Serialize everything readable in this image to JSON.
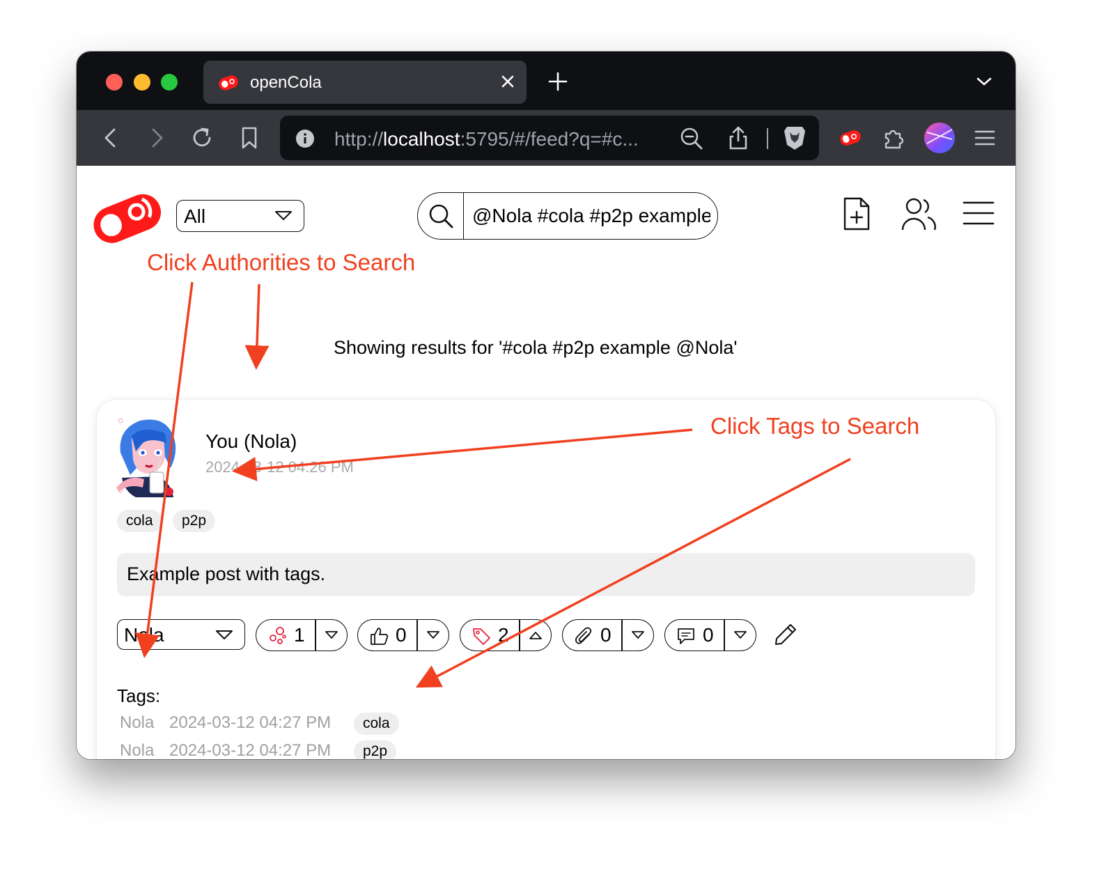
{
  "browser": {
    "tab_title": "openCola",
    "url_scheme": "http://",
    "url_host": "localhost",
    "url_rest": ":5795/#/feed?q=#c..."
  },
  "app": {
    "filter": {
      "selected": "All"
    },
    "search": {
      "value": "@Nola #cola #p2p example"
    },
    "results_text": "Showing results for '#cola #p2p example @Nola'"
  },
  "post": {
    "author": "You (Nola)",
    "date": "2024-03-12 04:26 PM",
    "tags": [
      "cola",
      "p2p"
    ],
    "body": "Example post with tags.",
    "persona": "Nola",
    "actions": {
      "likes_count": "1",
      "thumbs_count": "0",
      "tags_count": "2",
      "attachments_count": "0",
      "comments_count": "0"
    },
    "tags_label": "Tags:",
    "tag_rows": [
      {
        "author": "Nola",
        "date": "2024-03-12 04:27 PM",
        "tag": "cola"
      },
      {
        "author": "Nola",
        "date": "2024-03-12 04:27 PM",
        "tag": "p2p"
      }
    ]
  },
  "annotations": {
    "authorities": "Click Authorities to Search",
    "tags": "Click Tags to Search",
    "color": "#f0401f"
  }
}
